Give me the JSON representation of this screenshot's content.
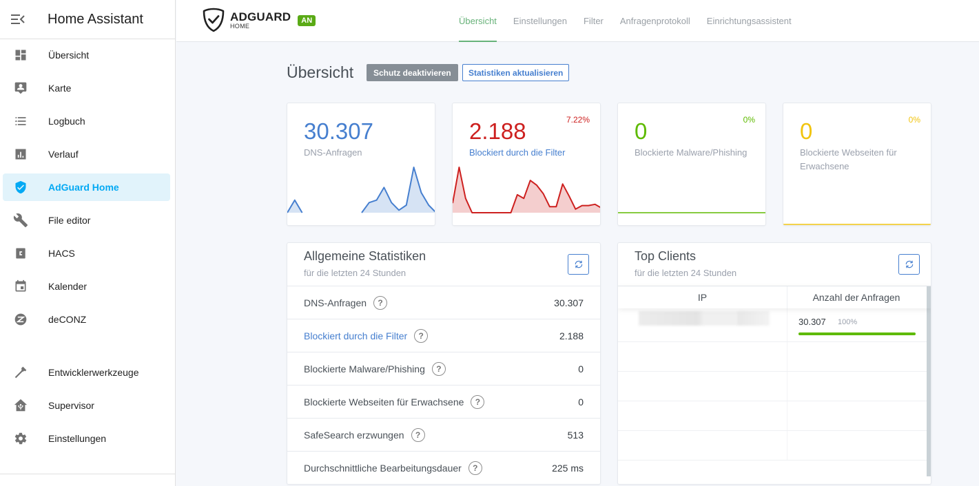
{
  "sidebar": {
    "title": "Home Assistant",
    "items": [
      {
        "label": "Übersicht",
        "icon": "dashboard-icon"
      },
      {
        "label": "Karte",
        "icon": "map-account-icon"
      },
      {
        "label": "Logbuch",
        "icon": "logbook-list-icon"
      },
      {
        "label": "Verlauf",
        "icon": "chart-bar-icon"
      },
      {
        "label": "AdGuard Home",
        "icon": "shield-check-icon",
        "active": true
      },
      {
        "label": "File editor",
        "icon": "wrench-icon"
      },
      {
        "label": "HACS",
        "icon": "hacs-icon"
      },
      {
        "label": "Kalender",
        "icon": "calendar-icon"
      },
      {
        "label": "deCONZ",
        "icon": "zigbee-icon"
      }
    ],
    "bottom_items": [
      {
        "label": "Entwicklerwerkzeuge",
        "icon": "hammer-icon"
      },
      {
        "label": "Supervisor",
        "icon": "home-assistant-icon"
      },
      {
        "label": "Einstellungen",
        "icon": "cog-icon"
      }
    ]
  },
  "header": {
    "logo_title": "ADGUARD",
    "logo_subtitle": "HOME",
    "status_badge": "AN",
    "nav": [
      "Übersicht",
      "Einstellungen",
      "Filter",
      "Anfragenprotokoll",
      "Einrichtungsassistent"
    ],
    "active_nav": "Übersicht"
  },
  "page": {
    "title": "Übersicht",
    "btn_disable": "Schutz deaktivieren",
    "btn_refresh": "Statistiken aktualisieren"
  },
  "colors": {
    "blue": "#467fcf",
    "red": "#cd201f",
    "green": "#5eba00",
    "yellow": "#f1c40f"
  },
  "stat_cards": [
    {
      "value": "30.307",
      "label": "DNS-Anfragen",
      "percent": "",
      "color": "#467fcf"
    },
    {
      "value": "2.188",
      "label": "Blockiert durch die Filter",
      "percent": "7.22%",
      "color": "#cd201f"
    },
    {
      "value": "0",
      "label": "Blockierte Malware/Phishing",
      "percent": "0%",
      "color": "#5eba00"
    },
    {
      "value": "0",
      "label": "Blockierte Webseiten für Erwachsene",
      "percent": "0%",
      "color": "#f1c40f"
    }
  ],
  "chart_data": [
    {
      "type": "area",
      "title": "DNS-Anfragen",
      "x": [
        0,
        1,
        2,
        3,
        4,
        5,
        6,
        7,
        8,
        9,
        10,
        11,
        12,
        13,
        14,
        15,
        16,
        17,
        18,
        19,
        20
      ],
      "values": [
        0,
        5,
        0,
        null,
        null,
        null,
        null,
        null,
        null,
        null,
        0,
        4,
        5,
        10,
        4,
        1,
        3,
        18,
        8,
        3,
        0
      ],
      "color": "#467fcf"
    },
    {
      "type": "area",
      "title": "Blockiert durch die Filter",
      "x": [
        0,
        1,
        2,
        3,
        4,
        5,
        6,
        7,
        8,
        9,
        10,
        11,
        12,
        13,
        14,
        15,
        16,
        17,
        18,
        19,
        20,
        21,
        22,
        23
      ],
      "values": [
        8,
        38,
        12,
        0,
        0,
        0,
        0,
        0,
        0,
        0,
        15,
        12,
        27,
        23,
        16,
        5,
        5,
        24,
        14,
        3,
        6,
        6,
        7,
        4
      ],
      "color": "#cd201f"
    },
    {
      "type": "area",
      "title": "Blockierte Malware/Phishing",
      "x": [
        0,
        1
      ],
      "values": [
        0,
        0
      ],
      "color": "#5eba00"
    },
    {
      "type": "area",
      "title": "Blockierte Webseiten für Erwachsene",
      "x": [
        0,
        1
      ],
      "values": [
        0,
        0
      ],
      "color": "#f1c40f"
    }
  ],
  "general_stats": {
    "title": "Allgemeine Statistiken",
    "subtitle": "für die letzten 24 Stunden",
    "rows": [
      {
        "label": "DNS-Anfragen",
        "value": "30.307"
      },
      {
        "label": "Blockiert durch die Filter",
        "value": "2.188",
        "link": true
      },
      {
        "label": "Blockierte Malware/Phishing",
        "value": "0"
      },
      {
        "label": "Blockierte Webseiten für Erwachsene",
        "value": "0"
      },
      {
        "label": "SafeSearch erzwungen",
        "value": "513"
      },
      {
        "label": "Durchschnittliche Bearbeitungsdauer",
        "value": "225 ms"
      }
    ]
  },
  "top_clients": {
    "title": "Top Clients",
    "subtitle": "für die letzten 24 Stunden",
    "columns": [
      "IP",
      "Anzahl der Anfragen"
    ],
    "rows": [
      {
        "ip": "",
        "count": "30.307",
        "percent": "100%",
        "fraction": 1.0
      }
    ]
  }
}
